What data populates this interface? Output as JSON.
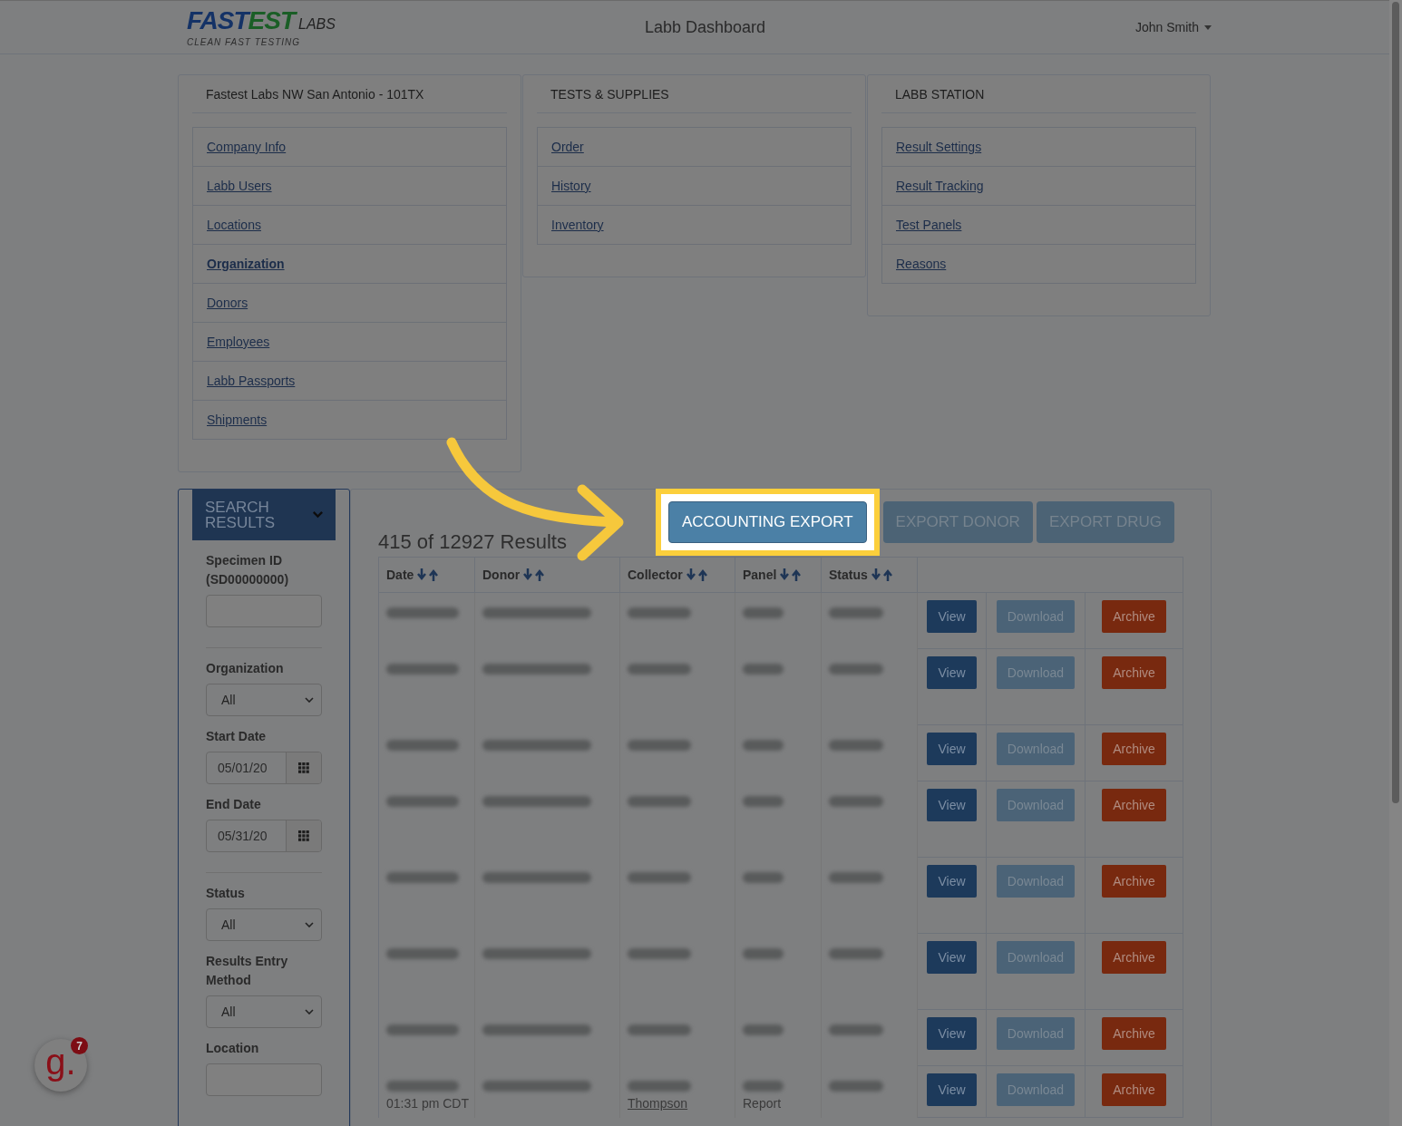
{
  "header": {
    "logo": {
      "word1": "FAST",
      "word2": "EST",
      "suffix": "LABS",
      "tagline": "CLEAN FAST TESTING"
    },
    "title": "Labb Dashboard",
    "user": "John Smith"
  },
  "cards": [
    {
      "title": "Fastest Labs NW San Antonio - 101TX",
      "links": [
        {
          "label": "Company Info",
          "selected": false
        },
        {
          "label": "Labb Users",
          "selected": false
        },
        {
          "label": "Locations",
          "selected": false
        },
        {
          "label": "Organization",
          "selected": true
        },
        {
          "label": "Donors",
          "selected": false
        },
        {
          "label": "Employees",
          "selected": false
        },
        {
          "label": "Labb Passports",
          "selected": false
        },
        {
          "label": "Shipments",
          "selected": false
        }
      ]
    },
    {
      "title": "TESTS & SUPPLIES",
      "links": [
        {
          "label": "Order",
          "selected": false
        },
        {
          "label": "History",
          "selected": false
        },
        {
          "label": "Inventory",
          "selected": false
        }
      ]
    },
    {
      "title": "LABB STATION",
      "links": [
        {
          "label": "Result Settings",
          "selected": false
        },
        {
          "label": "Result Tracking",
          "selected": false
        },
        {
          "label": "Test Panels",
          "selected": false
        },
        {
          "label": "Reasons",
          "selected": false
        }
      ]
    }
  ],
  "sidebar": {
    "toggle": "SEARCH RESULTS",
    "fields": [
      {
        "kind": "text",
        "label": "Specimen ID (SD00000000)",
        "divider": true
      },
      {
        "kind": "select",
        "label": "Organization",
        "value": "All",
        "divider": false
      },
      {
        "kind": "date",
        "label": "Start Date",
        "value": "05/01/20",
        "divider": false
      },
      {
        "kind": "date",
        "label": "End Date",
        "value": "05/31/20",
        "divider": true
      },
      {
        "kind": "select",
        "label": "Status",
        "value": "All",
        "divider": false
      },
      {
        "kind": "select",
        "label": "Results Entry Method",
        "value": "All",
        "divider": false
      },
      {
        "kind": "text",
        "label": "Location",
        "divider": false
      }
    ]
  },
  "results": {
    "count": "415 of 12927 Results",
    "buttons": [
      {
        "label": "ACCOUNTING EXPORT",
        "highlighted": true
      },
      {
        "label": "EXPORT DONOR",
        "highlighted": false
      },
      {
        "label": "EXPORT DRUG",
        "highlighted": false
      }
    ],
    "columns": [
      "Date",
      "Donor",
      "Collector",
      "Panel",
      "Status"
    ],
    "rows": [
      {
        "actions": [
          "View",
          "Download",
          "Archive"
        ]
      },
      {
        "actions": [
          "View",
          "Download",
          "Archive"
        ]
      },
      {
        "actions": [
          "View",
          "Download",
          "Archive"
        ]
      },
      {
        "actions": [
          "View",
          "Download",
          "Archive"
        ]
      },
      {
        "actions": [
          "View",
          "Download",
          "Archive"
        ]
      },
      {
        "actions": [
          "View",
          "Download",
          "Archive"
        ]
      },
      {
        "actions": [
          "View",
          "Download",
          "Archive"
        ]
      },
      {
        "date": "01:31 pm CDT",
        "collector": "Thompson",
        "panel": "Report",
        "actions": [
          "View",
          "Download",
          "Archive"
        ]
      }
    ]
  },
  "guide_widget": {
    "logo": "g.",
    "badge": "7"
  }
}
